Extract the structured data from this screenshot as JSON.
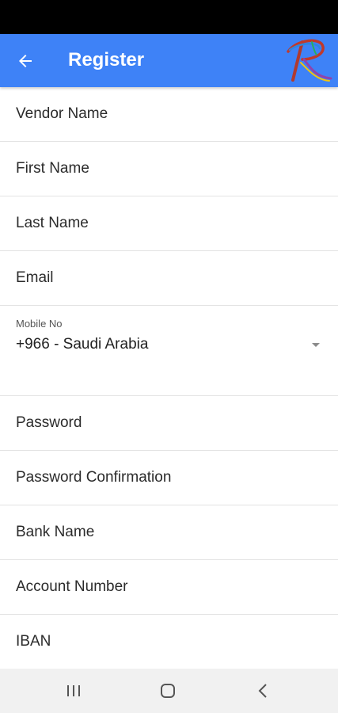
{
  "app_bar": {
    "title": "Register",
    "back_icon": "arrow-left-icon",
    "logo_letter": "R",
    "color": "#3e82f7"
  },
  "form": {
    "vendor_name": {
      "placeholder": "Vendor Name"
    },
    "first_name": {
      "placeholder": "First Name"
    },
    "last_name": {
      "placeholder": "Last Name"
    },
    "email": {
      "placeholder": "Email"
    },
    "mobile": {
      "label": "Mobile No",
      "country": "+966 - Saudi Arabia"
    },
    "password": {
      "placeholder": "Password"
    },
    "password_confirmation": {
      "placeholder": "Password Confirmation"
    },
    "bank_name": {
      "placeholder": "Bank Name"
    },
    "account_number": {
      "placeholder": "Account Number"
    },
    "iban": {
      "placeholder": "IBAN"
    }
  },
  "nav_bar": {
    "recents_icon": "recents-icon",
    "home_icon": "home-icon",
    "back_icon": "back-chevron-icon"
  }
}
